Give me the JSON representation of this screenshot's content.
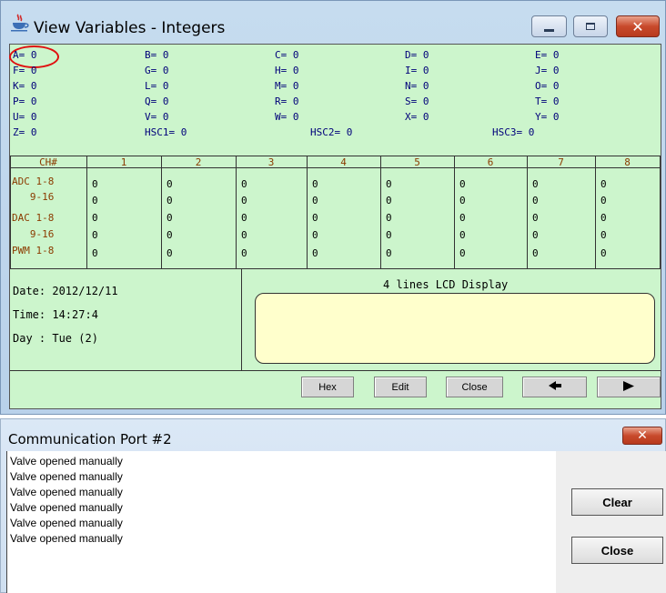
{
  "window1": {
    "title": "View Variables - Integers",
    "icon": "java-cup-icon",
    "controls": {
      "minimize": "minimize-icon",
      "maximize": "maximize-icon",
      "close": "close-icon"
    }
  },
  "variables": [
    {
      "name": "A",
      "value": "A= 0"
    },
    {
      "name": "B",
      "value": "B= 0"
    },
    {
      "name": "C",
      "value": "C= 0"
    },
    {
      "name": "D",
      "value": "D= 0"
    },
    {
      "name": "E",
      "value": "E= 0"
    },
    {
      "name": "F",
      "value": "F= 0"
    },
    {
      "name": "G",
      "value": "G= 0"
    },
    {
      "name": "H",
      "value": "H= 0"
    },
    {
      "name": "I",
      "value": "I= 0"
    },
    {
      "name": "J",
      "value": "J= 0"
    },
    {
      "name": "K",
      "value": "K= 0"
    },
    {
      "name": "L",
      "value": "L= 0"
    },
    {
      "name": "M",
      "value": "M= 0"
    },
    {
      "name": "N",
      "value": "N= 0"
    },
    {
      "name": "O",
      "value": "O= 0"
    },
    {
      "name": "P",
      "value": "P= 0"
    },
    {
      "name": "Q",
      "value": "Q= 0"
    },
    {
      "name": "R",
      "value": "R= 0"
    },
    {
      "name": "S",
      "value": "S= 0"
    },
    {
      "name": "T",
      "value": "T= 0"
    },
    {
      "name": "U",
      "value": "U= 0"
    },
    {
      "name": "V",
      "value": "V= 0"
    },
    {
      "name": "W",
      "value": "W= 0"
    },
    {
      "name": "X",
      "value": "X= 0"
    },
    {
      "name": "Y",
      "value": "Y= 0"
    },
    {
      "name": "Z",
      "value": "Z= 0"
    },
    {
      "name": "HSC1",
      "value": "HSC1= 0"
    },
    {
      "name": "HSC2",
      "value": "HSC2= 0"
    },
    {
      "name": "HSC3",
      "value": "HSC3= 0"
    }
  ],
  "channels": {
    "headers": [
      "CH#",
      "1",
      "2",
      "3",
      "4",
      "5",
      "6",
      "7",
      "8"
    ],
    "rows": [
      {
        "label": "ADC 1-8",
        "values": [
          "0",
          "0",
          "0",
          "0",
          "0",
          "0",
          "0",
          "0"
        ]
      },
      {
        "label": "   9-16",
        "values": [
          "0",
          "0",
          "0",
          "0",
          "0",
          "0",
          "0",
          "0"
        ]
      },
      {
        "label": "DAC 1-8",
        "values": [
          "0",
          "0",
          "0",
          "0",
          "0",
          "0",
          "0",
          "0"
        ]
      },
      {
        "label": "   9-16",
        "values": [
          "0",
          "0",
          "0",
          "0",
          "0",
          "0",
          "0",
          "0"
        ]
      },
      {
        "label": "PWM 1-8",
        "values": [
          "0",
          "0",
          "0",
          "0",
          "0",
          "0",
          "0",
          "0"
        ]
      }
    ]
  },
  "datetime": {
    "date": "Date: 2012/12/11",
    "time": "Time: 14:27:4",
    "day": "Day : Tue (2)"
  },
  "lcd": {
    "title": "4 lines LCD Display",
    "lines": [
      "",
      "",
      "",
      ""
    ]
  },
  "buttons1": [
    "Hex",
    "Edit",
    "Close"
  ],
  "nav": {
    "prev": "left-arrow-icon",
    "next": "right-arrow-icon"
  },
  "window2": {
    "title": "Communication Port #2",
    "log": [
      "Valve opened manually",
      "Valve opened manually",
      "Valve opened manually",
      "Valve opened manually",
      "Valve opened manually",
      "Valve opened manually"
    ],
    "clear_label": "Clear",
    "close_label": "Close"
  },
  "colors": {
    "panel_green": "#ccf5cc",
    "lcd_yellow": "#ffffcc",
    "variable_text": "#00007a",
    "header_text": "#8b3b00",
    "highlight": "#e01010"
  }
}
